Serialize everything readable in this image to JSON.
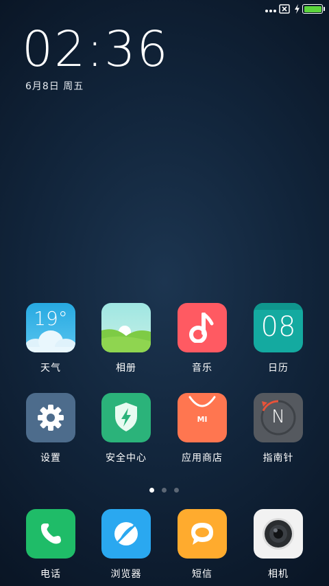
{
  "status_bar": {
    "battery_level": 1.0,
    "charging": true
  },
  "lock": {
    "time": "02:36",
    "date": "6月8日 周五"
  },
  "apps": [
    {
      "id": "weather",
      "label": "天气",
      "icon": "weather-icon",
      "text": "19°"
    },
    {
      "id": "gallery",
      "label": "相册",
      "icon": "gallery-icon"
    },
    {
      "id": "music",
      "label": "音乐",
      "icon": "music-note-icon"
    },
    {
      "id": "calendar",
      "label": "日历",
      "icon": "calendar-icon",
      "text": "08"
    },
    {
      "id": "settings",
      "label": "设置",
      "icon": "gear-icon"
    },
    {
      "id": "security",
      "label": "安全中心",
      "icon": "shield-bolt-icon"
    },
    {
      "id": "store",
      "label": "应用商店",
      "icon": "shopping-bag-icon",
      "text": "MI"
    },
    {
      "id": "compass",
      "label": "指南针",
      "icon": "compass-icon",
      "text": "N"
    }
  ],
  "dock": [
    {
      "id": "phone",
      "label": "电话",
      "icon": "phone-icon"
    },
    {
      "id": "browser",
      "label": "浏览器",
      "icon": "browser-icon"
    },
    {
      "id": "messages",
      "label": "短信",
      "icon": "message-icon"
    },
    {
      "id": "camera",
      "label": "相机",
      "icon": "camera-icon"
    }
  ],
  "pager": {
    "current": 1,
    "total": 3
  },
  "colors": {
    "weather": "#3fb4e6",
    "gallery": "#a8e8e4",
    "music": "#ff5a62",
    "calendar": "#14aaa0",
    "settings": "#4d6c8c",
    "security": "#2bb37a",
    "store": "#ff7650",
    "compass": "#55595f",
    "phone": "#1fbc68",
    "browser": "#2aa8f0",
    "messages": "#ffab2e",
    "camera": "#f2f2f2",
    "battery": "#5bd43c"
  }
}
